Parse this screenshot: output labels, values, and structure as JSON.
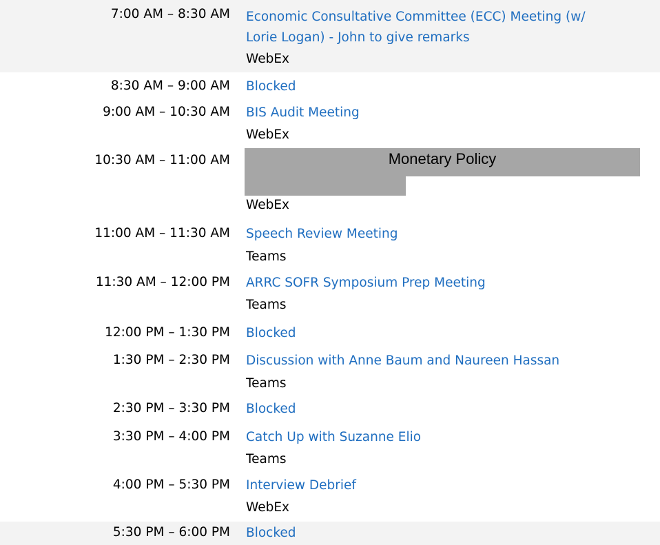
{
  "colors": {
    "link": "#1f6ec0",
    "text": "#000000",
    "shade": "#f3f3f3",
    "redaction": "#a6a6a6"
  },
  "events": [
    {
      "time": "7:00 AM – 8:30 AM",
      "title_line1": "Economic Consultative Committee (ECC) Meeting (w/",
      "title_line2": "Lorie Logan) - John to give remarks",
      "location": "WebEx"
    },
    {
      "time": "8:30 AM – 9:00 AM",
      "title": "Blocked"
    },
    {
      "time": "9:00 AM – 10:30 AM",
      "title": "BIS Audit Meeting",
      "location": "WebEx"
    },
    {
      "time": "10:30 AM – 11:00 AM",
      "redaction_label": "Monetary Policy",
      "location": "WebEx"
    },
    {
      "time": "11:00 AM – 11:30 AM",
      "title": "Speech Review Meeting",
      "location": "Teams"
    },
    {
      "time": "11:30 AM – 12:00 PM",
      "title": "ARRC SOFR Symposium Prep Meeting",
      "location": "Teams"
    },
    {
      "time": "12:00 PM – 1:30 PM",
      "title": "Blocked"
    },
    {
      "time": "1:30 PM – 2:30 PM",
      "title": "Discussion with Anne Baum and Naureen Hassan",
      "location": "Teams"
    },
    {
      "time": "2:30 PM – 3:30 PM",
      "title": "Blocked"
    },
    {
      "time": "3:30 PM – 4:00 PM",
      "title": "Catch Up with Suzanne Elio",
      "location": "Teams"
    },
    {
      "time": "4:00 PM – 5:30 PM",
      "title": "Interview Debrief",
      "location": "WebEx"
    },
    {
      "time": "5:30 PM – 6:00 PM",
      "title": "Blocked"
    }
  ]
}
